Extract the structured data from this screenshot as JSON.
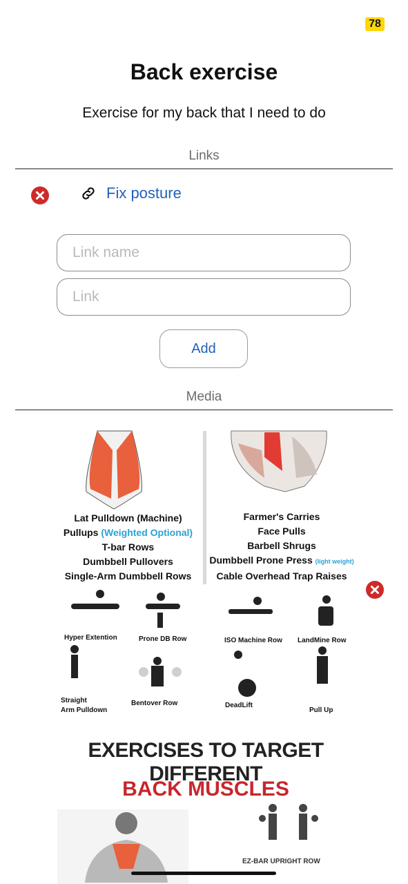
{
  "status_bar": {
    "badge": "78"
  },
  "page": {
    "title": "Back exercise",
    "description": "Exercise for my back that I need to do"
  },
  "links_section": {
    "label": "Links",
    "items": [
      {
        "name": "Fix posture"
      }
    ],
    "link_name_placeholder": "Link name",
    "link_placeholder": "Link",
    "add_label": "Add"
  },
  "media_section": {
    "label": "Media",
    "image1": {
      "left_list": [
        "Lat Pulldown (Machine)",
        "Pullups",
        "(Weighted Optional)",
        "T-bar Rows",
        "Dumbbell Pullovers",
        "Single-Arm Dumbbell Rows"
      ],
      "right_list": [
        "Farmer's Carries",
        "Face Pulls",
        "Barbell Shrugs",
        "Dumbbell Prone Press",
        "(light weight)",
        "Cable Overhead Trap Raises"
      ],
      "exercises": [
        "Hyper Extention",
        "Prone DB Row",
        "ISO Machine Row",
        "LandMine Row",
        "Straight",
        "Arm Pulldown",
        "Bentover Row",
        "DeadLift",
        "Pull Up"
      ]
    },
    "image2": {
      "heading": "EXERCISES TO TARGET DIFFERENT",
      "subheading": "BACK MUSCLES",
      "caption": "EZ-BAR UPRIGHT ROW"
    }
  },
  "colors": {
    "accent": "#2361b8",
    "remove": "#cf2a2a",
    "badge": "#ffd60a",
    "muscle": "#e8603c"
  },
  "icons": {
    "remove": "close-circle-icon",
    "link": "link-icon"
  }
}
